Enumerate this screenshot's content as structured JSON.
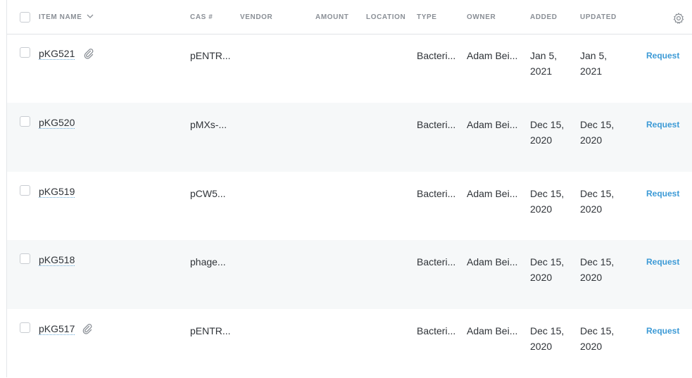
{
  "header": {
    "columns": {
      "item_name": "ITEM NAME",
      "cas": "CAS #",
      "vendor": "VENDOR",
      "amount": "AMOUNT",
      "location": "LOCATION",
      "type": "TYPE",
      "owner": "OWNER",
      "added": "ADDED",
      "updated": "UPDATED"
    }
  },
  "rows": [
    {
      "name": "pKG521",
      "attachment": true,
      "cas": "pENTR...",
      "type": "Bacteri...",
      "owner": "Adam Bei...",
      "added": "Jan 5, 2021",
      "updated": "Jan 5, 2021",
      "action": "Request"
    },
    {
      "name": "pKG520",
      "attachment": false,
      "cas": "pMXs-...",
      "type": "Bacteri...",
      "owner": "Adam Bei...",
      "added": "Dec 15, 2020",
      "updated": "Dec 15, 2020",
      "action": "Request"
    },
    {
      "name": "pKG519",
      "attachment": false,
      "cas": "pCW5...",
      "type": "Bacteri...",
      "owner": "Adam Bei...",
      "added": "Dec 15, 2020",
      "updated": "Dec 15, 2020",
      "action": "Request"
    },
    {
      "name": "pKG518",
      "attachment": false,
      "cas": "phage...",
      "type": "Bacteri...",
      "owner": "Adam Bei...",
      "added": "Dec 15, 2020",
      "updated": "Dec 15, 2020",
      "action": "Request"
    },
    {
      "name": "pKG517",
      "attachment": true,
      "cas": "pENTR...",
      "type": "Bacteri...",
      "owner": "Adam Bei...",
      "added": "Dec 15, 2020",
      "updated": "Dec 15, 2020",
      "action": "Request"
    }
  ],
  "icons": {
    "header_sort": "chevron-down-icon",
    "settings": "gear-icon",
    "attachment": "paperclip-icon"
  },
  "colors": {
    "link": "#3c9ad6",
    "alt_row": "#f6f8f9"
  }
}
